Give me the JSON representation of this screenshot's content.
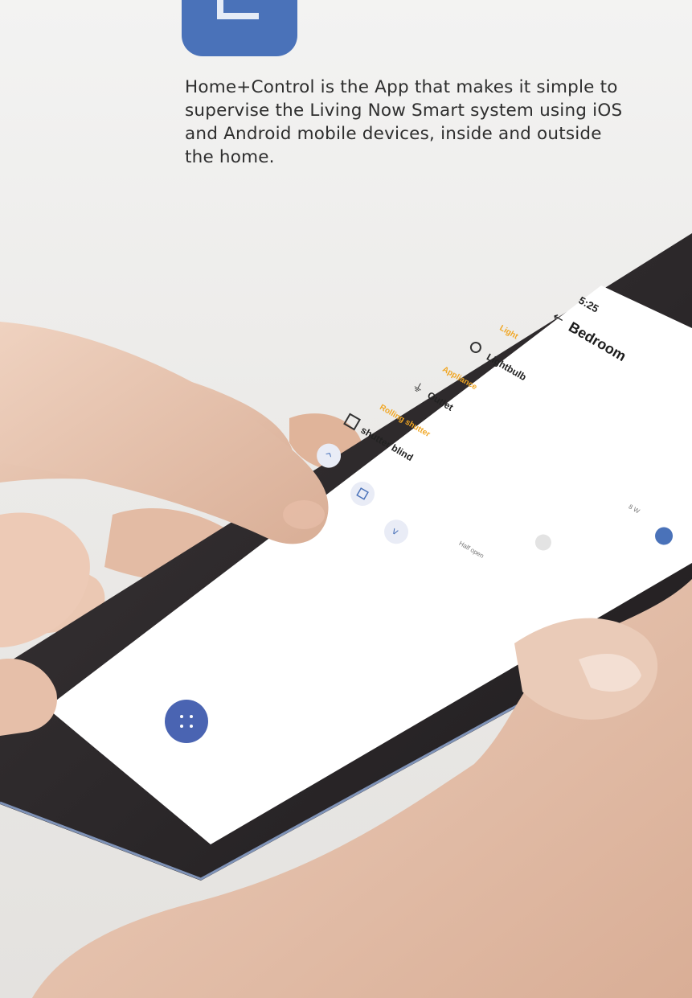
{
  "intro_text": "Home+Control is the App that makes it simple to supervise the Living Now Smart system using iOS and Android mobile devices, inside and outside the home.",
  "colors": {
    "brand_blue": "#4a72b9",
    "section_orange": "#f0a623",
    "phone_body": "#2b2729",
    "skin": "#e6c2ac"
  },
  "phone_screen": {
    "status_time": "5:25",
    "back_icon": "arrow-left-icon",
    "room_title": "Bedroom",
    "sections": [
      {
        "label": "Light",
        "items": [
          {
            "icon": "lightbulb-icon",
            "label": "Lightbulb"
          }
        ]
      },
      {
        "label": "Appliance",
        "items": [
          {
            "icon": "plug-icon",
            "label": "Outlet",
            "value": "8 W",
            "toggle_on": true
          }
        ]
      },
      {
        "label": "Rolling shutter",
        "items": [
          {
            "icon": "shutter-icon",
            "label": "shutter blind",
            "toggle_on": false,
            "status": "Half open"
          }
        ]
      }
    ],
    "shutter_controls": [
      "chevron-up-icon",
      "stop-icon",
      "chevron-down-icon"
    ],
    "fab_icon": "grid-dots-icon"
  }
}
